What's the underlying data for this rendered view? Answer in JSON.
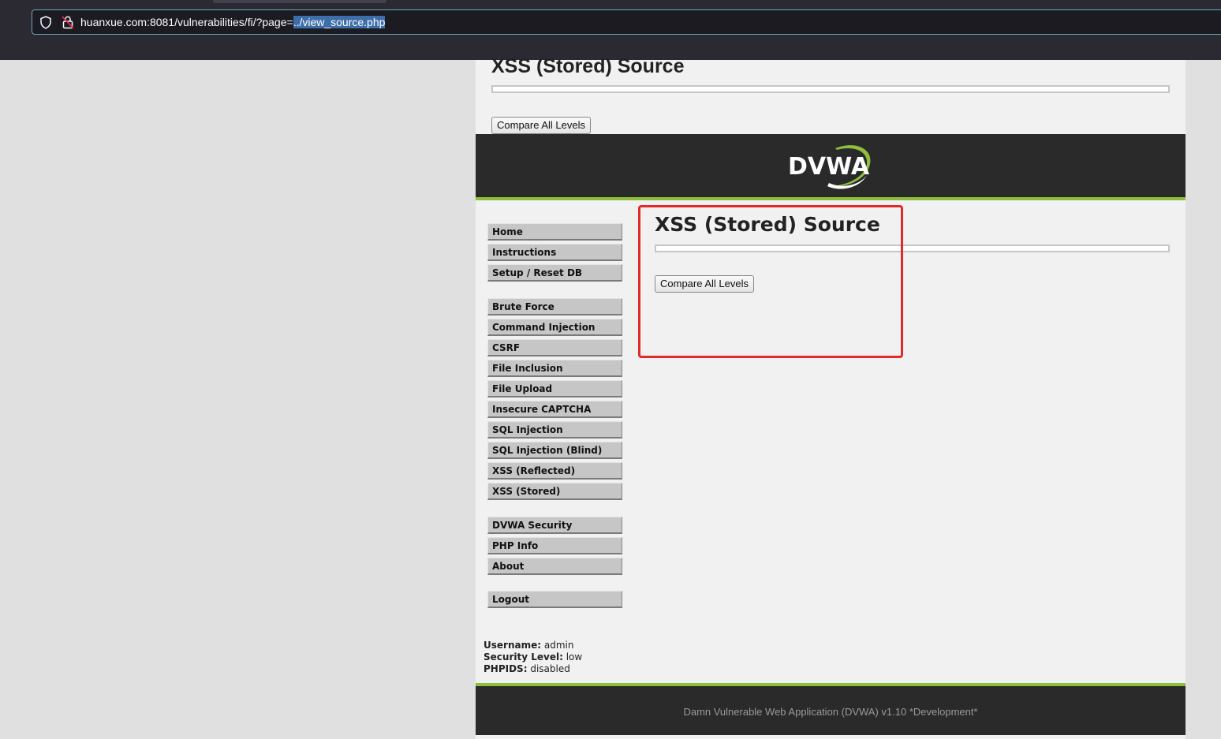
{
  "browser": {
    "url_prefix": "huanxue.com:8081/vulnerabilities/fi/?page=",
    "url_selected": "../view_source.php"
  },
  "page": {
    "outer_title": "XSS (Stored) Source",
    "outer_button": "Compare All Levels",
    "logo_text": "DVWA",
    "inner_title": "XSS (Stored) Source",
    "inner_button": "Compare All Levels"
  },
  "menu": {
    "group1": [
      "Home",
      "Instructions",
      "Setup / Reset DB"
    ],
    "group2": [
      "Brute Force",
      "Command Injection",
      "CSRF",
      "File Inclusion",
      "File Upload",
      "Insecure CAPTCHA",
      "SQL Injection",
      "SQL Injection (Blind)",
      "XSS (Reflected)",
      "XSS (Stored)"
    ],
    "group3": [
      "DVWA Security",
      "PHP Info",
      "About"
    ],
    "group4": [
      "Logout"
    ]
  },
  "user_info": {
    "username_label": "Username:",
    "username": "admin",
    "security_label": "Security Level:",
    "security": "low",
    "phpids_label": "PHPIDS:",
    "phpids": "disabled"
  },
  "footer": {
    "text": "Damn Vulnerable Web Application (DVWA) v1.10 *Development*"
  },
  "colors": {
    "accent_green": "#8fbe3e",
    "header_dark": "#2a2a2a",
    "highlight_red": "#e22a2a"
  }
}
